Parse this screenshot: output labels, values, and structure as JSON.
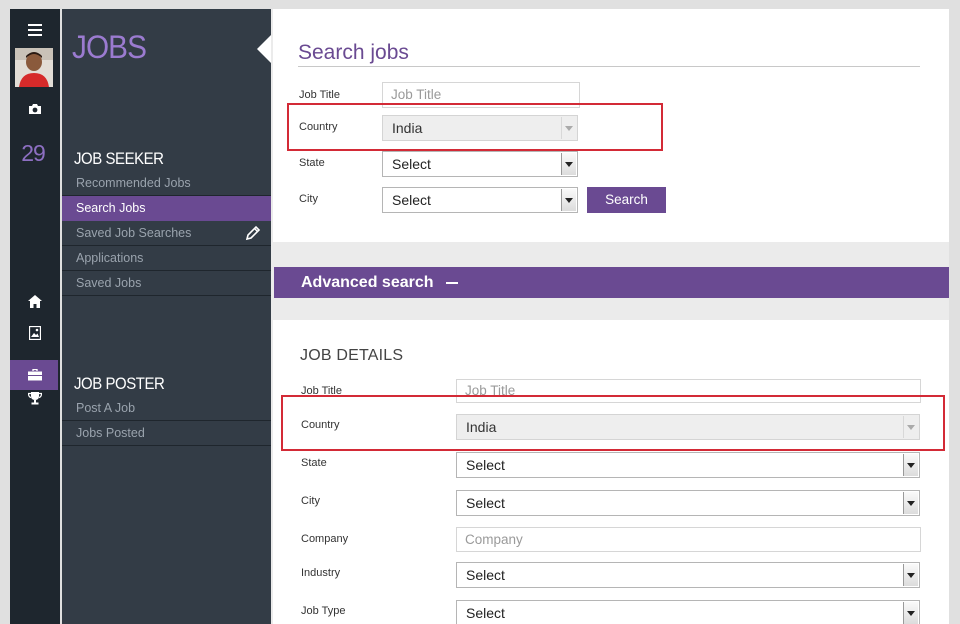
{
  "rail": {
    "count": "29",
    "icons": [
      "menu-icon",
      "camera-icon",
      "home-icon",
      "image-icon",
      "briefcase-icon",
      "trophy-icon"
    ]
  },
  "sidebar": {
    "title": "JOBS",
    "seeker": {
      "title": "JOB SEEKER",
      "items": [
        {
          "label": "Recommended Jobs"
        },
        {
          "label": "Search Jobs"
        },
        {
          "label": "Saved Job Searches"
        },
        {
          "label": "Applications"
        },
        {
          "label": "Saved Jobs"
        }
      ]
    },
    "poster": {
      "title": "JOB POSTER",
      "items": [
        {
          "label": "Post A Job"
        },
        {
          "label": "Jobs Posted"
        }
      ]
    }
  },
  "search": {
    "title": "Search jobs",
    "job_title_label": "Job Title",
    "job_title_placeholder": "Job Title",
    "country_label": "Country",
    "country_value": "India",
    "state_label": "State",
    "state_value": "Select",
    "city_label": "City",
    "city_value": "Select",
    "button": "Search"
  },
  "advanced": {
    "label": "Advanced search"
  },
  "details": {
    "title": "JOB DETAILS",
    "job_title_label": "Job Title",
    "job_title_placeholder": "Job Title",
    "country_label": "Country",
    "country_value": "India",
    "state_label": "State",
    "state_value": "Select",
    "city_label": "City",
    "city_value": "Select",
    "company_label": "Company",
    "company_placeholder": "Company",
    "industry_label": "Industry",
    "industry_value": "Select",
    "job_type_label": "Job Type",
    "job_type_value": "Select"
  },
  "colors": {
    "accent": "#6a4a92",
    "highlight": "#d32a36",
    "rail_bg": "#1e262e",
    "sidebar_bg": "#333c46"
  }
}
